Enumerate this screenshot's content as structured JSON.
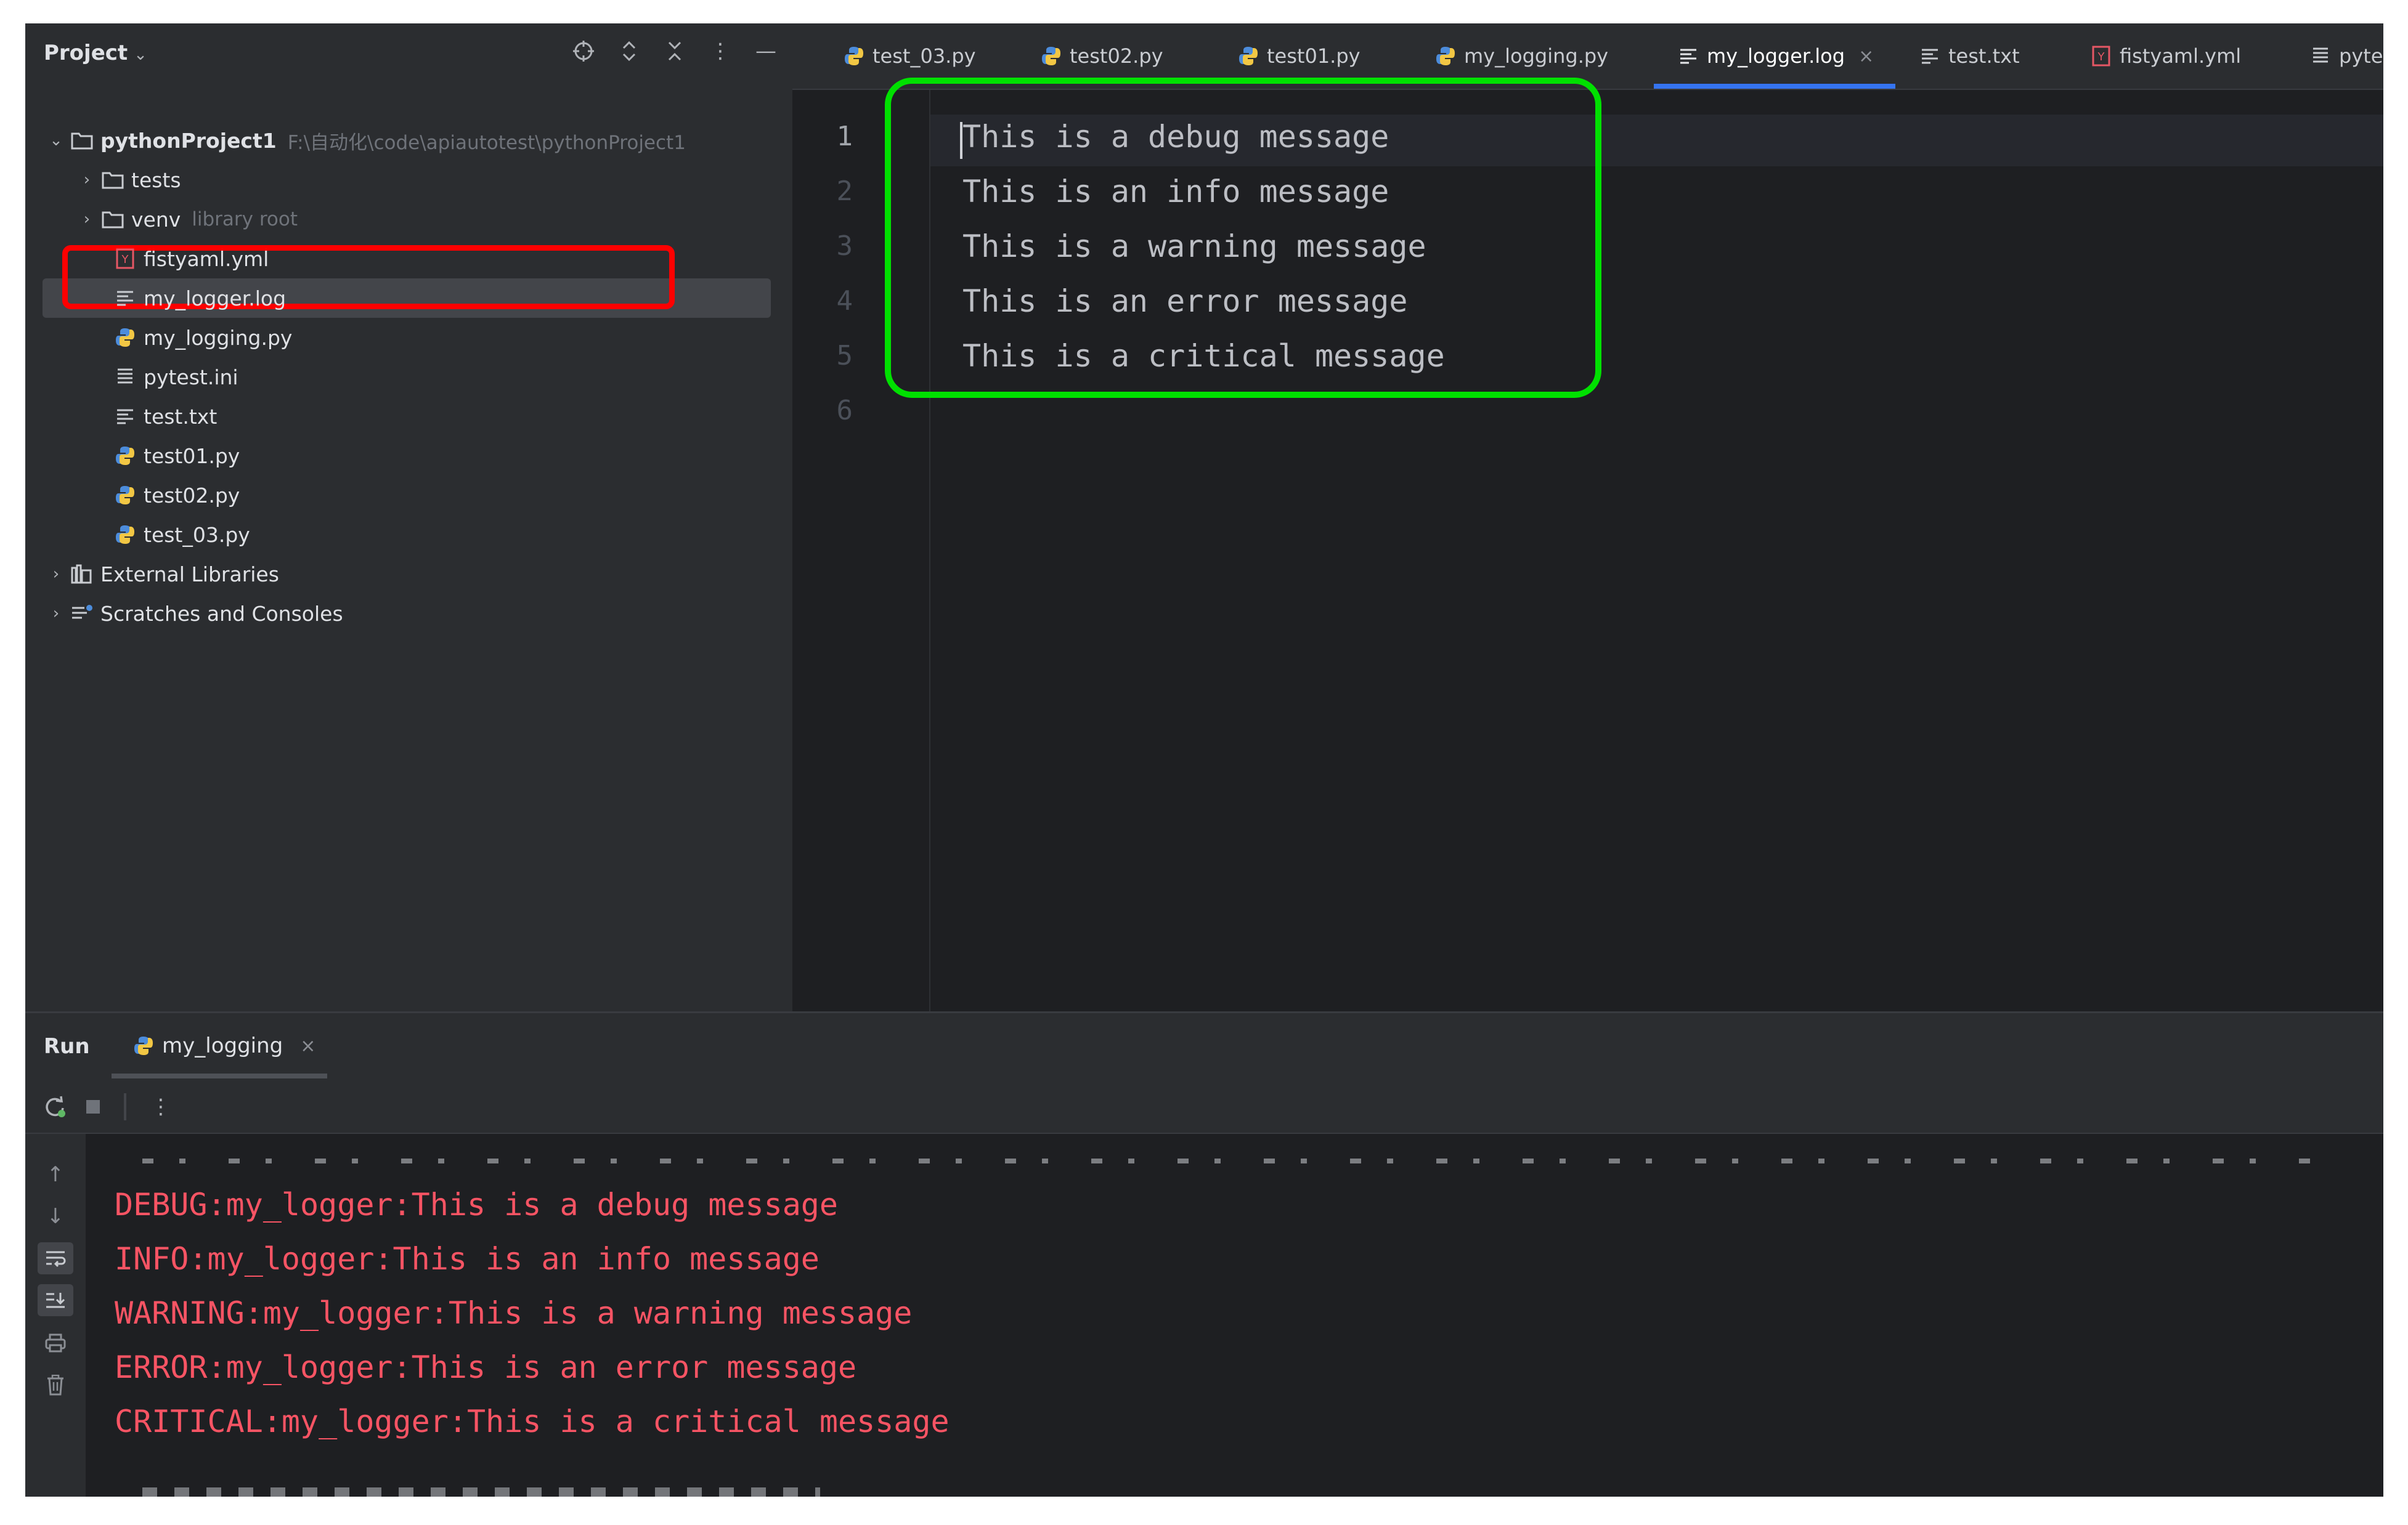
{
  "project": {
    "title": "Project",
    "tree": [
      {
        "arrow": "v",
        "icon": "folder-icon",
        "label": "pythonProject1",
        "bold": true,
        "muted": "F:\\自动化\\code\\apiautotest\\pythonProject1",
        "indent": 0
      },
      {
        "arrow": ">",
        "icon": "folder-icon",
        "label": "tests",
        "indent": 1
      },
      {
        "arrow": ">",
        "icon": "folder-icon",
        "label": "venv",
        "muted": "library root",
        "indent": 1
      },
      {
        "icon": "yaml-file-icon",
        "label": "fistyaml.yml",
        "indent": 2
      },
      {
        "icon": "text-file-icon",
        "label": "my_logger.log",
        "indent": 2,
        "selected": true
      },
      {
        "icon": "python-file-icon",
        "label": "my_logging.py",
        "indent": 2
      },
      {
        "icon": "ini-file-icon",
        "label": "pytest.ini",
        "indent": 2
      },
      {
        "icon": "text-file-icon",
        "label": "test.txt",
        "indent": 2
      },
      {
        "icon": "python-file-icon",
        "label": "test01.py",
        "indent": 2
      },
      {
        "icon": "python-file-icon",
        "label": "test02.py",
        "indent": 2
      },
      {
        "icon": "python-file-icon",
        "label": "test_03.py",
        "indent": 2
      },
      {
        "arrow": ">",
        "icon": "library-icon",
        "label": "External Libraries",
        "indent": 0
      },
      {
        "arrow": ">",
        "icon": "scratches-icon",
        "label": "Scratches and Consoles",
        "indent": 0
      }
    ]
  },
  "tabs": [
    {
      "icon": "python-file-icon",
      "label": "test_03.py"
    },
    {
      "icon": "python-file-icon",
      "label": "test02.py"
    },
    {
      "icon": "python-file-icon",
      "label": "test01.py"
    },
    {
      "icon": "python-file-icon",
      "label": "my_logging.py"
    },
    {
      "icon": "text-file-icon",
      "label": "my_logger.log",
      "active": true,
      "close": "×"
    },
    {
      "icon": "text-file-icon",
      "label": "test.txt"
    },
    {
      "icon": "yaml-file-icon",
      "label": "fistyaml.yml"
    },
    {
      "icon": "ini-file-icon",
      "label": "pytest.i"
    }
  ],
  "editor": {
    "line_numbers": [
      "1",
      "2",
      "3",
      "4",
      "5",
      "6"
    ],
    "lines": [
      "This is a debug message",
      "This is an info message",
      "This is a warning message",
      "This is an error message",
      "This is a critical message"
    ]
  },
  "run": {
    "title": "Run",
    "tab_label": "my_logging",
    "tab_close": "×",
    "output": [
      "DEBUG:my_logger:This is a debug message",
      "INFO:my_logger:This is an info message",
      "WARNING:my_logger:This is a warning message",
      "ERROR:my_logger:This is an error message",
      "CRITICAL:my_logger:This is a critical message"
    ]
  },
  "colors": {
    "highlight_red": "#ff0000",
    "highlight_green": "#00e000",
    "output_text": "#f75464",
    "accent_tab": "#3574f0"
  }
}
